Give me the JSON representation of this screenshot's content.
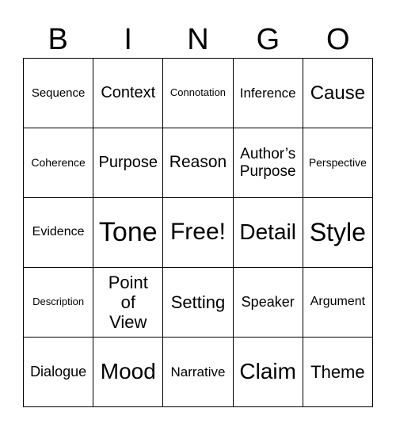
{
  "header": [
    "B",
    "I",
    "N",
    "G",
    "O"
  ],
  "cells": [
    "Sequence",
    "Context",
    "Connotation",
    "Inference",
    "Cause",
    "Coherence",
    "Purpose",
    "Reason",
    "Author’s Purpose",
    "Perspective",
    "Evidence",
    "Tone",
    "Free!",
    "Detail",
    "Style",
    "Description",
    "Point of View",
    "Setting",
    "Speaker",
    "Argument",
    "Dialogue",
    "Mood",
    "Narrative",
    "Claim",
    "Theme"
  ]
}
